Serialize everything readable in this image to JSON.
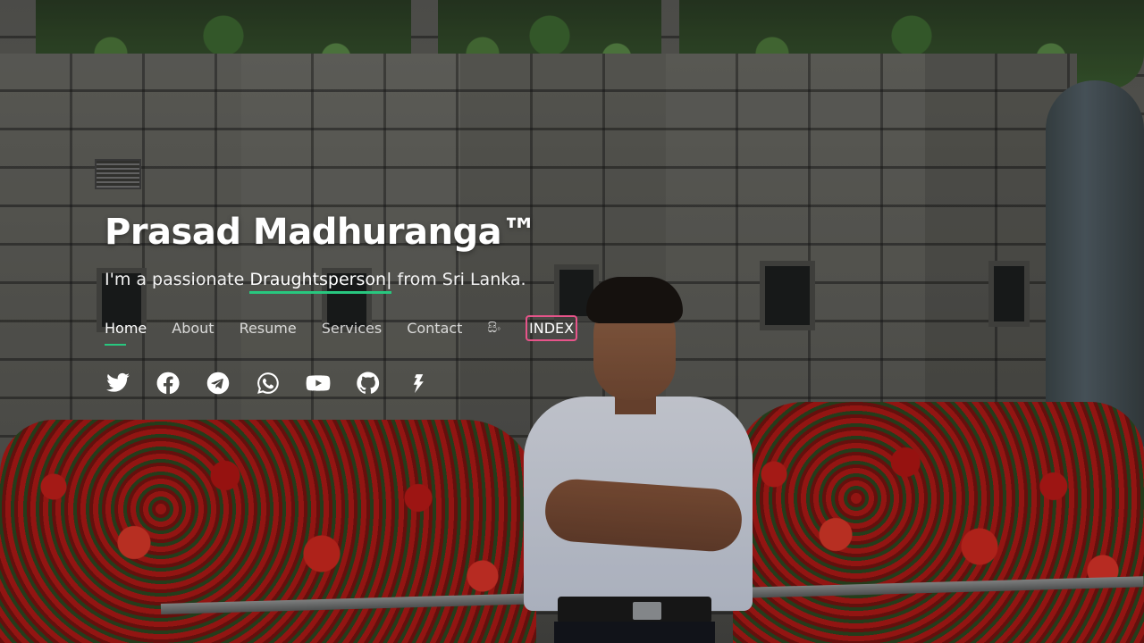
{
  "hero": {
    "title": "Prasad Madhuranga™",
    "subtitle_prefix": "I'm a passionate",
    "typed_word": "Draughtsperson",
    "cursor": "|",
    "subtitle_suffix": "from Sri Lanka."
  },
  "nav": {
    "items": [
      {
        "label": "Home",
        "active": true
      },
      {
        "label": "About"
      },
      {
        "label": "Resume"
      },
      {
        "label": "Services"
      },
      {
        "label": "Contact"
      },
      {
        "label": "සිං"
      },
      {
        "label": "INDEX"
      }
    ]
  },
  "social": {
    "icons": [
      "twitter-icon",
      "facebook-icon",
      "telegram-icon",
      "whatsapp-icon",
      "youtube-icon",
      "github-icon",
      "zhihu-icon"
    ]
  },
  "colors": {
    "accent": "#28c77f",
    "index_border": "#e7548a",
    "text": "#ffffff"
  }
}
